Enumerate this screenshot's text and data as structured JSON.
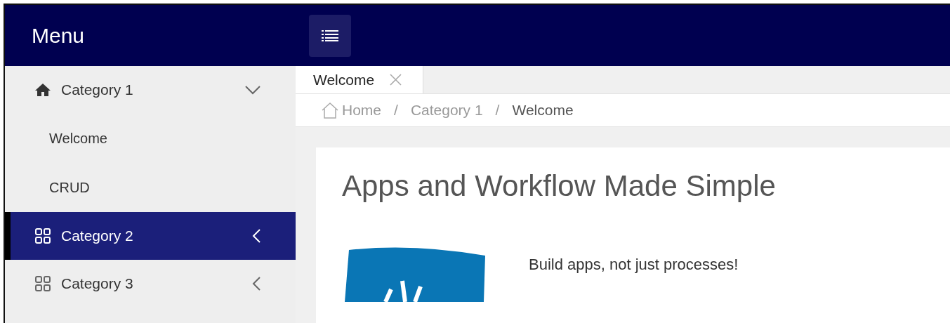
{
  "header": {
    "title": "Menu"
  },
  "sidebar": {
    "items": [
      {
        "label": "Category 1",
        "kind": "home",
        "expanded": true,
        "selected": false,
        "children": [
          {
            "label": "Welcome"
          },
          {
            "label": "CRUD"
          }
        ]
      },
      {
        "label": "Category 2",
        "kind": "grid",
        "expanded": false,
        "selected": true
      },
      {
        "label": "Category 3",
        "kind": "grid",
        "expanded": false,
        "selected": false
      }
    ]
  },
  "tabs": [
    {
      "label": "Welcome",
      "selected": true,
      "closable": true
    }
  ],
  "breadcrumb": [
    {
      "label": "Home",
      "home": true
    },
    {
      "label": "Category 1"
    },
    {
      "label": "Welcome",
      "current": true
    }
  ],
  "breadcrumb_separator": "/",
  "content": {
    "heading": "Apps and Workflow Made Simple",
    "tagline": "Build apps, not just processes!"
  }
}
